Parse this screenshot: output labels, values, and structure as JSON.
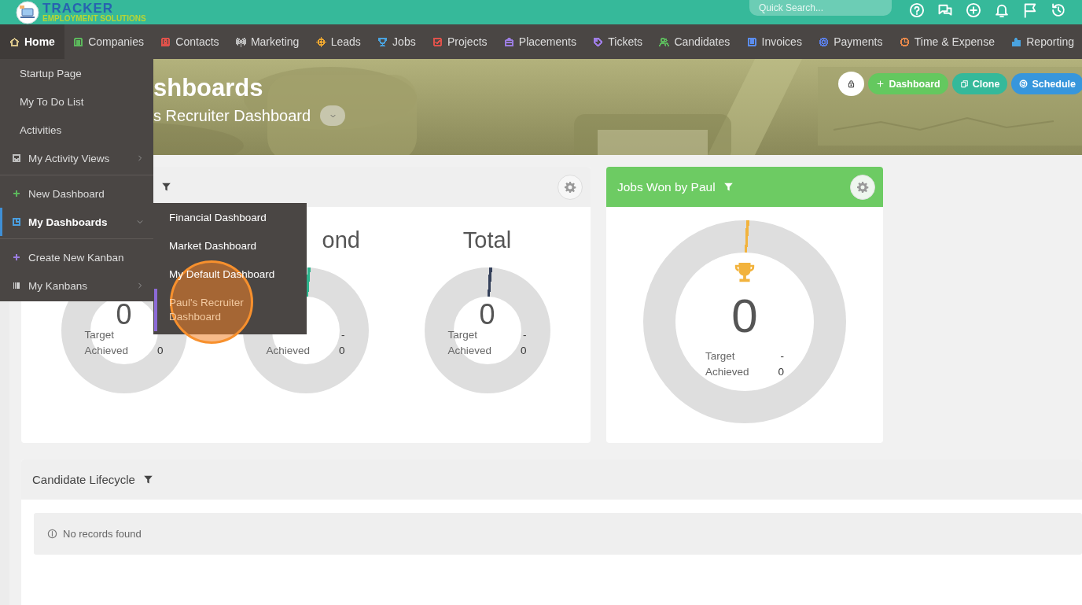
{
  "header": {
    "brand": "TRACKER",
    "tagline": "EMPLOYMENT SOLUTIONS",
    "search": {
      "placeholder": "Quick Search..."
    },
    "tools": [
      {
        "kind": "help"
      },
      {
        "kind": "chat"
      },
      {
        "kind": "add"
      },
      {
        "kind": "bell"
      },
      {
        "kind": "flag"
      },
      {
        "kind": "history"
      }
    ]
  },
  "nav": [
    {
      "label": "Home",
      "kind": "home",
      "selected": true,
      "color": "#d9c58a"
    },
    {
      "label": "Companies",
      "kind": "companies",
      "selected": false,
      "color": "#5cb85c"
    },
    {
      "label": "Contacts",
      "kind": "contacts",
      "selected": false,
      "color": "#e0524b"
    },
    {
      "label": "Marketing",
      "kind": "marketing",
      "selected": false,
      "color": "#bdbdbd"
    },
    {
      "label": "Leads",
      "kind": "leads",
      "selected": false,
      "color": "#f0a830"
    },
    {
      "label": "Jobs",
      "kind": "jobs",
      "selected": false,
      "color": "#4aa3df"
    },
    {
      "label": "Projects",
      "kind": "projects",
      "selected": false,
      "color": "#e0524b"
    },
    {
      "label": "Placements",
      "kind": "placements",
      "selected": false,
      "color": "#9b7de0"
    },
    {
      "label": "Tickets",
      "kind": "tickets",
      "selected": false,
      "color": "#a07ee8"
    },
    {
      "label": "Candidates",
      "kind": "candidates",
      "selected": false,
      "color": "#5cb85c"
    },
    {
      "label": "Invoices",
      "kind": "invoices",
      "selected": false,
      "color": "#5b8def"
    },
    {
      "label": "Payments",
      "kind": "payments",
      "selected": false,
      "color": "#5b7fe8"
    },
    {
      "label": "Time & Expense",
      "kind": "time",
      "selected": false,
      "color": "#ee8a4a"
    },
    {
      "label": "Reporting",
      "kind": "reporting",
      "selected": false,
      "color": "#4aa3df"
    }
  ],
  "home_menu": {
    "groups": [
      [
        {
          "label": "Startup Page",
          "kind": "link",
          "selected": false
        },
        {
          "label": "My To Do List",
          "kind": "link",
          "selected": false
        },
        {
          "label": "Activities",
          "kind": "link",
          "selected": false
        },
        {
          "label": "My Activity Views",
          "kind": "views",
          "selected": false,
          "expanded": false,
          "color": "#bdbdbd"
        }
      ],
      [
        {
          "label": "New Dashboard",
          "kind": "add",
          "selected": false,
          "color": "#5cb85c"
        },
        {
          "label": "My Dashboards",
          "kind": "dashboards",
          "selected": true,
          "expanded": true,
          "color": "#4a9fe0"
        }
      ],
      [
        {
          "label": "Create New Kanban",
          "kind": "add",
          "selected": false,
          "color": "#9a7de0"
        },
        {
          "label": "My Kanbans",
          "kind": "kanbans",
          "selected": false,
          "expanded": false,
          "color": "#d0d0d0"
        }
      ]
    ]
  },
  "dashboards_submenu": {
    "items": [
      {
        "label": "Financial Dashboard",
        "selected": false
      },
      {
        "label": "Market Dashboard",
        "selected": false
      },
      {
        "label": "My Default Dashboard",
        "selected": false
      },
      {
        "label": "Paul's Recruiter Dashboard",
        "selected": true
      }
    ],
    "click_marker": true
  },
  "hero": {
    "title": "shboards",
    "subtitle": "s Recruiter Dashboard",
    "actions": [
      {
        "kind": "lock"
      },
      {
        "kind": "add",
        "label": "Dashboard"
      },
      {
        "kind": "clone",
        "label": "Clone"
      },
      {
        "kind": "schedule",
        "label": "Schedule"
      }
    ]
  },
  "widgets": [
    {
      "kind": "gauges",
      "filter": true,
      "settings": true,
      "gauges": [
        {
          "value": "0",
          "target_label": "Target",
          "achieved_label": "Achieved",
          "achieved": "0"
        },
        {
          "title": "ond",
          "target": "-",
          "achieved_label": "Achieved",
          "achieved": "0",
          "color": "#2db38c"
        },
        {
          "title": "Total",
          "value": "0",
          "target_label": "Target",
          "target": "-",
          "achieved_label": "Achieved",
          "achieved": "0",
          "color": "#34405a"
        }
      ]
    },
    {
      "kind": "trophy",
      "title": "Jobs Won by Paul",
      "filter": true,
      "settings": true,
      "gauge": {
        "value": "0",
        "target_label": "Target",
        "target": "-",
        "achieved_label": "Achieved",
        "achieved": "0",
        "color": "#f2b33d"
      }
    },
    {
      "kind": "list",
      "title": "Candidate Lifecycle",
      "filter": true,
      "empty_text": "No records found"
    }
  ]
}
